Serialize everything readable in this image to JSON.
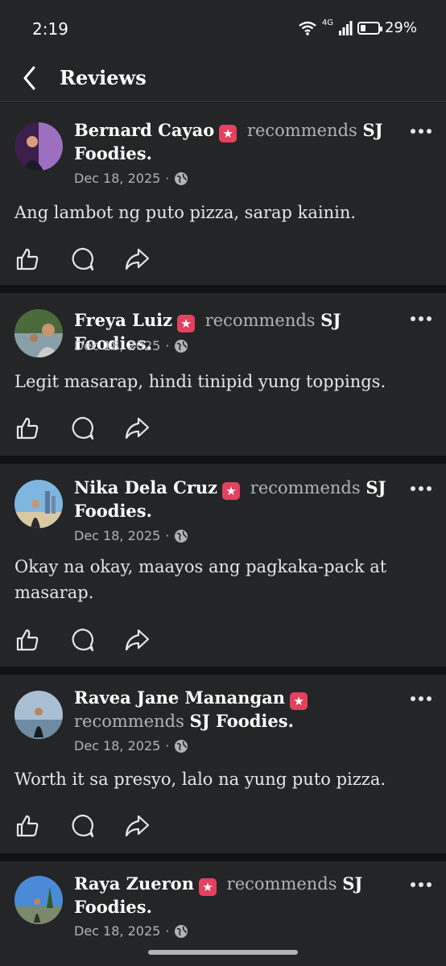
{
  "status_bar": {
    "time": "2:19",
    "network": "4G",
    "battery": "29%",
    "battery_level": 0.29
  },
  "header": {
    "title": "Reviews"
  },
  "reviews": [
    {
      "name": "Bernard Cayao",
      "recommends": "recommends",
      "page": "SJ Foodies.",
      "date": "Dec 18, 2025",
      "dot": "·",
      "text": "Ang lambot ng puto pizza, sarap kainin."
    },
    {
      "name": "Freya Luiz",
      "recommends": "recommends",
      "page": "SJ Foodies.",
      "date": "Dec 18, 2025",
      "dot": "·",
      "text": "Legit masarap, hindi tinipid yung toppings."
    },
    {
      "name": "Nika Dela Cruz",
      "recommends": "recommends",
      "page": "SJ Foodies.",
      "date": "Dec 18, 2025",
      "dot": "·",
      "text": "Okay na okay, maayos ang pagkaka-pack at masarap."
    },
    {
      "name": "Ravea Jane Manangan",
      "recommends": "recommends",
      "page": "SJ Foodies.",
      "date": "Dec 18, 2025",
      "dot": "·",
      "text": "Worth it sa presyo, lalo na yung puto pizza."
    },
    {
      "name": "Raya Zueron",
      "recommends": "recommends",
      "page": "SJ Foodies.",
      "date": "Dec 18, 2025",
      "dot": "·",
      "text": ""
    }
  ],
  "icons": {
    "badge": "recommend-star-icon",
    "privacy": "globe-icon",
    "more": "more-options-icon",
    "like": "thumbs-up-icon",
    "comment": "comment-icon",
    "share": "share-icon"
  },
  "colors": {
    "badge": "#e4405f",
    "background": "#242526"
  }
}
